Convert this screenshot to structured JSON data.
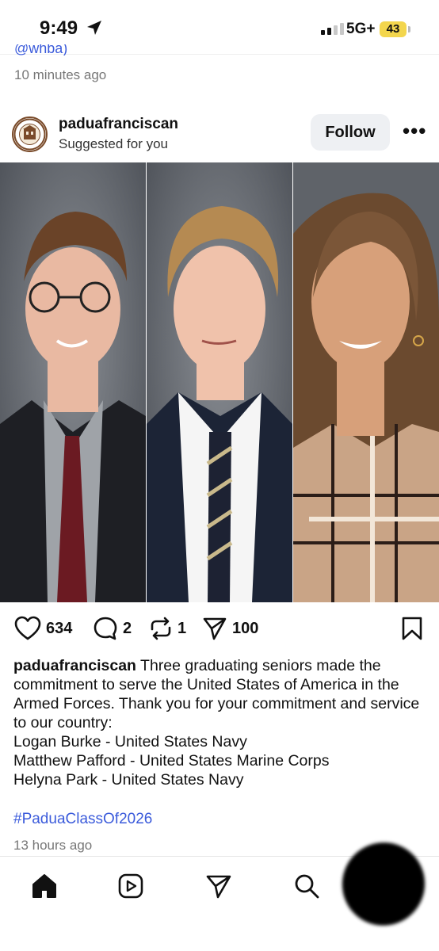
{
  "status_bar": {
    "time": "9:49",
    "network": "5G+",
    "battery": "43"
  },
  "previous_post": {
    "handle_fragment": "@whba)",
    "time": "10 minutes ago"
  },
  "post": {
    "username": "paduafranciscan",
    "subtitle": "Suggested for you",
    "follow_label": "Follow",
    "more_label": "•••",
    "counts": {
      "likes": "634",
      "comments": "2",
      "reposts": "1",
      "shares": "100"
    },
    "caption_username": "paduafranciscan",
    "caption_text": " Three graduating seniors made the commitment to serve the United States of America in the Armed Forces. Thank you for your commitment and service to our country:",
    "caption_lines": [
      "Logan Burke - United States Navy",
      "Matthew Pafford - United States Marine Corps",
      "Helyna Park - United States Navy"
    ],
    "hashtag": "#PaduaClassOf2026",
    "time": "13 hours ago"
  },
  "colors": {
    "link": "#3b5bdb",
    "battery": "#f3d64d",
    "follow_bg": "#eef0f3"
  },
  "tab_bar": [
    "home-icon",
    "reels-icon",
    "send-icon",
    "search-icon",
    "profile-avatar"
  ]
}
